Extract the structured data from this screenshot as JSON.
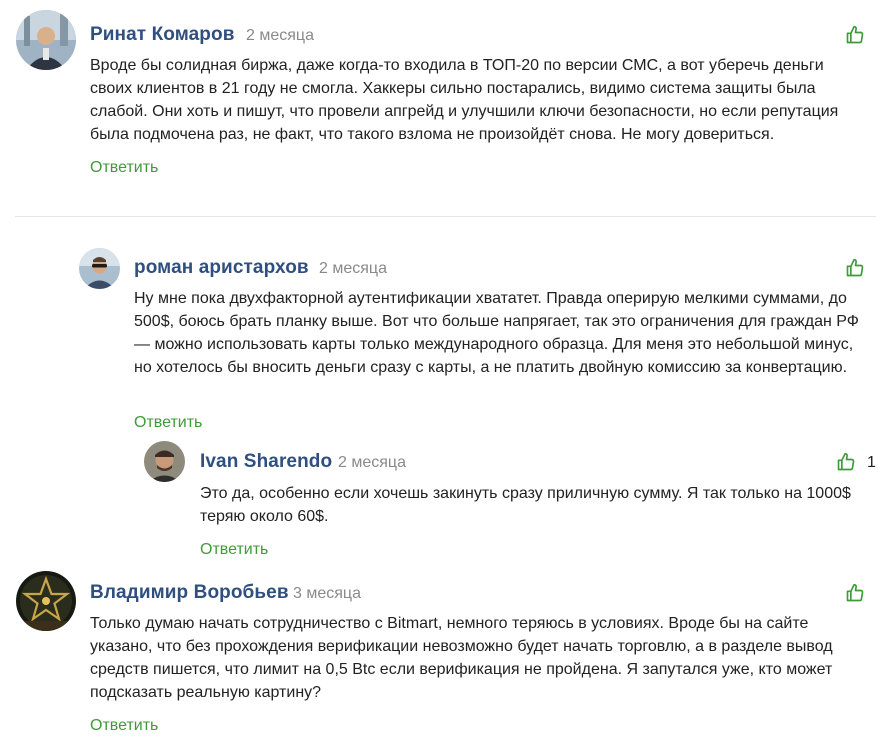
{
  "comments": [
    {
      "author": "Ринат Комаров",
      "date": "2 месяца",
      "text": "Вроде бы солидная биржа, даже когда-то входила в ТОП-20 по версии СМС, а вот уберечь деньги своих клиентов в 21 году не смогла. Хаккеры сильно постарались, видимо система защиты была слабой. Они хоть и пишут, что провели апгрейд и улучшили ключи безопасности, но если репутация была подмочена раз, не факт, что такого взлома не произойдёт снова. Не могу довериться.",
      "reply_label": "Ответить",
      "likes": ""
    },
    {
      "author": "роман аристархов",
      "date": "2 месяца",
      "text": "Ну мне пока двухфакторной аутентификации хвататет. Правда оперирую мелкими суммами, до 500$, боюсь брать планку выше. Вот что больше напрягает, так это ограничения для граждан РФ — можно использовать карты только международного образца. Для меня это небольшой минус, но хотелось бы вносить деньги сразу с карты, а не платить двойную комиссию за конвертацию.",
      "reply_label": "Ответить",
      "likes": ""
    },
    {
      "author": "Ivan Sharendo",
      "date": "2 месяца",
      "text": "Это да, особенно если хочешь закинуть сразу приличную сумму. Я так только на 1000$ теряю около 60$.",
      "reply_label": "Ответить",
      "likes": "1"
    },
    {
      "author": "Владимир Воробьев",
      "date": "3 месяца",
      "text": "Только думаю начать сотрудничество с Bitmart, немного теряюсь в условиях. Вроде бы на сайте указано, что без прохождения верификации невозможно будет начать торговлю, а в разделе вывод средств пишется, что лимит на 0,5 Btc если верификация не пройдена. Я запутался уже, кто может подсказать реальную картину?",
      "reply_label": "Ответить",
      "likes": ""
    }
  ],
  "icons": {
    "like": "thumbs-up-icon"
  },
  "colors": {
    "author": "#2f4f7f",
    "reply": "#3f9b3a",
    "like": "#3f9b3a",
    "date": "#8a8a8a"
  }
}
